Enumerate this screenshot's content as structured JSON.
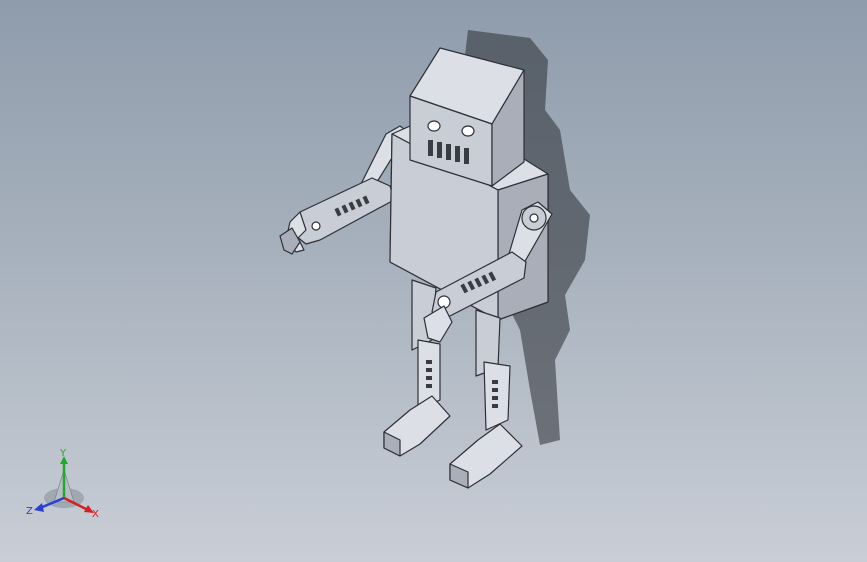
{
  "viewport": {
    "background_top": "#8f9cab",
    "background_bottom": "#c9ced6"
  },
  "model": {
    "face_color": "#c9cdd6",
    "face_light": "#dcdfe6",
    "face_dark": "#a9aeb8",
    "edge_color": "#2e3038",
    "shadow_color": "#2a2d33"
  },
  "triad": {
    "x_label": "X",
    "y_label": "Y",
    "z_label": "Z",
    "x_color": "#d42020",
    "y_color": "#1faa2a",
    "z_color": "#2a3fd0"
  }
}
